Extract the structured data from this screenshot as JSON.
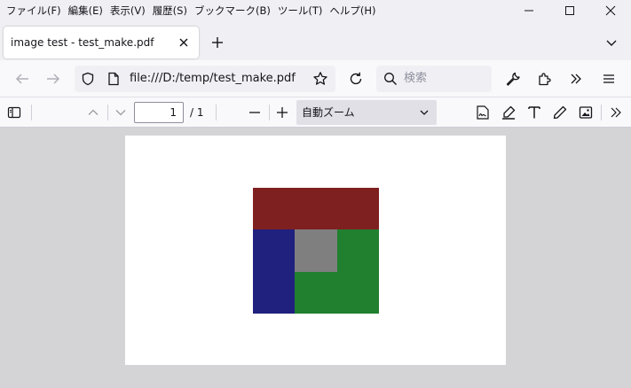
{
  "menu": {
    "items": [
      {
        "label": "ファイル(F)"
      },
      {
        "label": "編集(E)"
      },
      {
        "label": "表示(V)"
      },
      {
        "label": "履歴(S)"
      },
      {
        "label": "ブックマーク(B)"
      },
      {
        "label": "ツール(T)"
      },
      {
        "label": "ヘルプ(H)"
      }
    ]
  },
  "window_controls": {
    "minimize_icon": "minimize-icon",
    "maximize_icon": "maximize-icon",
    "close_icon": "close-icon"
  },
  "tabs": [
    {
      "title": "image test - test_make.pdf",
      "active": true
    }
  ],
  "navbar": {
    "url": "file:///D:/temp/test_make.pdf",
    "search_placeholder": "検索"
  },
  "pdf_toolbar": {
    "page_number": "1",
    "page_count": "/ 1",
    "zoom_label": "自動ズーム"
  },
  "pdf_page": {
    "image_colors": {
      "top": "#7f2020",
      "left": "#20207f",
      "right": "#20807f",
      "center": "#7f7f7f",
      "bottom": "#20802f"
    }
  },
  "colors": {
    "chrome_bg": "#f0f0f4",
    "toolbar_bg": "#f9f9fb",
    "viewer_bg": "#d4d4d7"
  }
}
